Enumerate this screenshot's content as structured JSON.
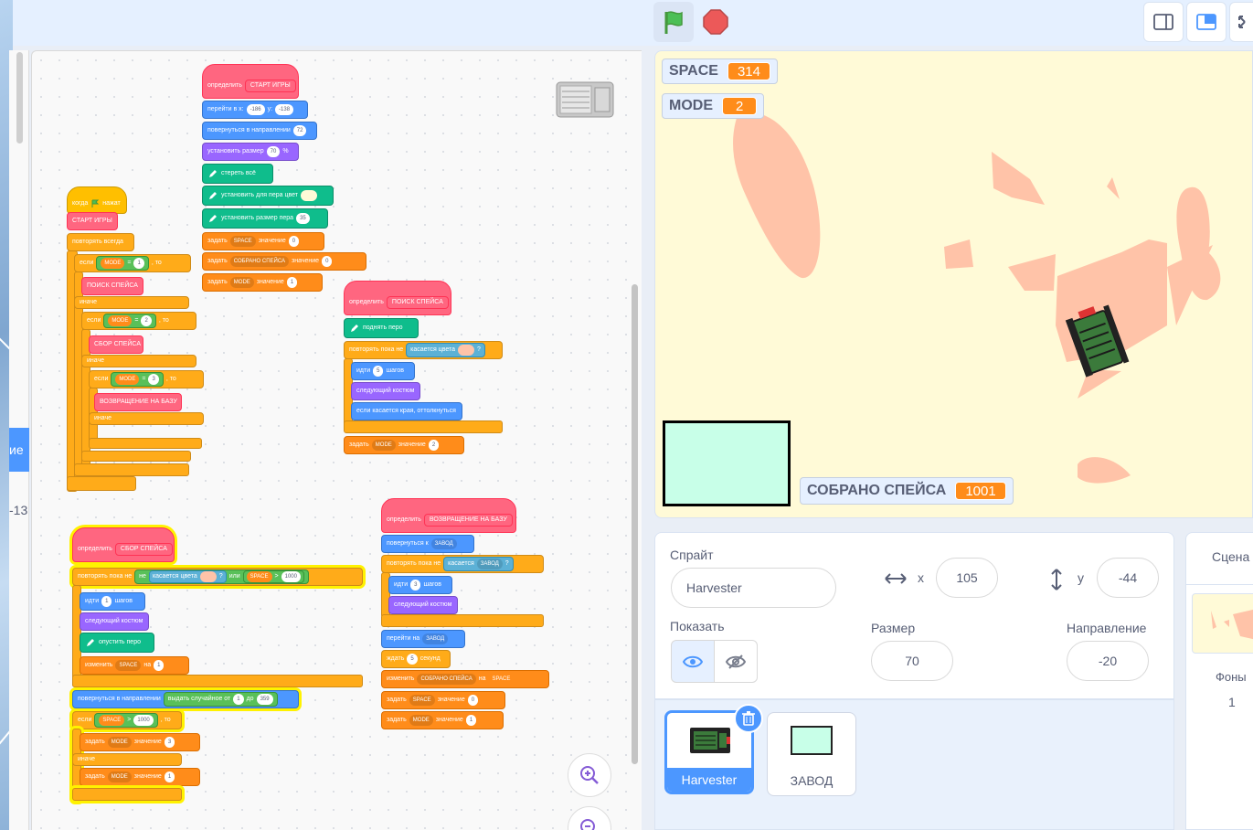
{
  "palette": {
    "tab_label": "ие",
    "coord_label": "-13"
  },
  "stage": {
    "monitors": [
      {
        "name": "SPACE",
        "value": "314"
      },
      {
        "name": "MODE",
        "value": "2"
      },
      {
        "name": "СОБРАНО СПЕЙСА",
        "value": "1001"
      }
    ],
    "colors": {
      "background": "#fffad7",
      "spice": "#ffc3a8",
      "base": "#c8ffe8"
    }
  },
  "sprite_info": {
    "sprite_label": "Спрайт",
    "sprite_name": "Harvester",
    "x_label": "x",
    "x_value": "105",
    "y_label": "y",
    "y_value": "-44",
    "show_label": "Показать",
    "size_label": "Размер",
    "size_value": "70",
    "direction_label": "Направление",
    "direction_value": "-20"
  },
  "sprites": [
    {
      "name": "Harvester",
      "selected": true
    },
    {
      "name": "ЗАВОД",
      "selected": false
    }
  ],
  "stage_pane": {
    "title": "Сцена",
    "backdrops_label": "Фоны",
    "backdrops_count": "1"
  },
  "scripts": {
    "main": {
      "hat_when": "когда",
      "hat_clicked": "нажат",
      "call_start": "СТАРТ ИГРЫ",
      "forever": "повторять всегда",
      "if1": "если",
      "then": ", то",
      "mode": "MODE",
      "eq": "=",
      "n1": "1",
      "n2": "2",
      "n3": "3",
      "call_search": "ПОИСК СПЕЙСА",
      "else": "иначе",
      "call_collect": "СБОР СПЕЙСА",
      "call_return": "ВОЗВРАЩЕНИЕ НА БАЗУ"
    },
    "start_def": {
      "define": "определить",
      "name": "СТАРТ ИГРЫ",
      "goto": "перейти в x:",
      "x": "-186",
      "y_lbl": "y:",
      "y": "-138",
      "point": "повернуться в направлении",
      "dir": "72",
      "size": "установить размер",
      "size_v": "70",
      "pct": "%",
      "clear": "стереть всё",
      "pen_color": "установить для пера цвет",
      "pen_size": "установить размер пера",
      "pen_size_v": "35",
      "set": "задать",
      "space": "SPACE",
      "to": "значение",
      "zero": "0",
      "collected": "СОБРАНО СПЕЙСА",
      "mode": "MODE",
      "one": "1"
    },
    "search_def": {
      "define": "определить",
      "name": "ПОИСК СПЕЙСА",
      "pen_up": "поднять перо",
      "repeat_until": "повторять пока не",
      "touching_color": "касается цвета",
      "q": "?",
      "move": "идти",
      "steps_v": "5",
      "steps": "шагов",
      "next_costume": "следующий костюм",
      "bounce": "если касается края, оттолкнуться",
      "set": "задать",
      "mode": "MODE",
      "to": "значение",
      "two": "2"
    },
    "collect_def": {
      "define": "определить",
      "name": "СБОР СПЕЙСА",
      "repeat_until": "повторять пока не",
      "not": "не",
      "touching_color": "касается цвета",
      "q": "?",
      "or": "или",
      "space": "SPACE",
      "gt": ">",
      "thousand": "1000",
      "move": "идти",
      "one": "1",
      "steps": "шагов",
      "next_costume": "следующий костюм",
      "pen_down": "опустить перо",
      "change": "изменить",
      "by": "на",
      "point": "повернуться в направлении",
      "pick_random": "выдать случайное от",
      "from_v": "1",
      "to_lbl": "до",
      "to_v": "359",
      "if": "если",
      "then": ", то",
      "set": "задать",
      "mode": "MODE",
      "value": "значение",
      "three": "3",
      "else": "иначе"
    },
    "return_def": {
      "define": "определить",
      "name": "ВОЗВРАЩЕНИЕ НА БАЗУ",
      "point_towards": "повернуться к",
      "factory": "ЗАВОД",
      "repeat_until": "повторять пока не",
      "touching": "касается",
      "q": "?",
      "move": "идти",
      "three": "3",
      "steps": "шагов",
      "next_costume": "следующий костюм",
      "goto": "перейти на",
      "wait": "ждать",
      "five": "5",
      "seconds": "секунд",
      "change": "изменить",
      "collected": "СОБРАНО СПЕЙСА",
      "by": "на",
      "space": "SPACE",
      "set": "задать",
      "to": "значение",
      "zero": "0",
      "mode": "MODE",
      "one": "1"
    }
  }
}
